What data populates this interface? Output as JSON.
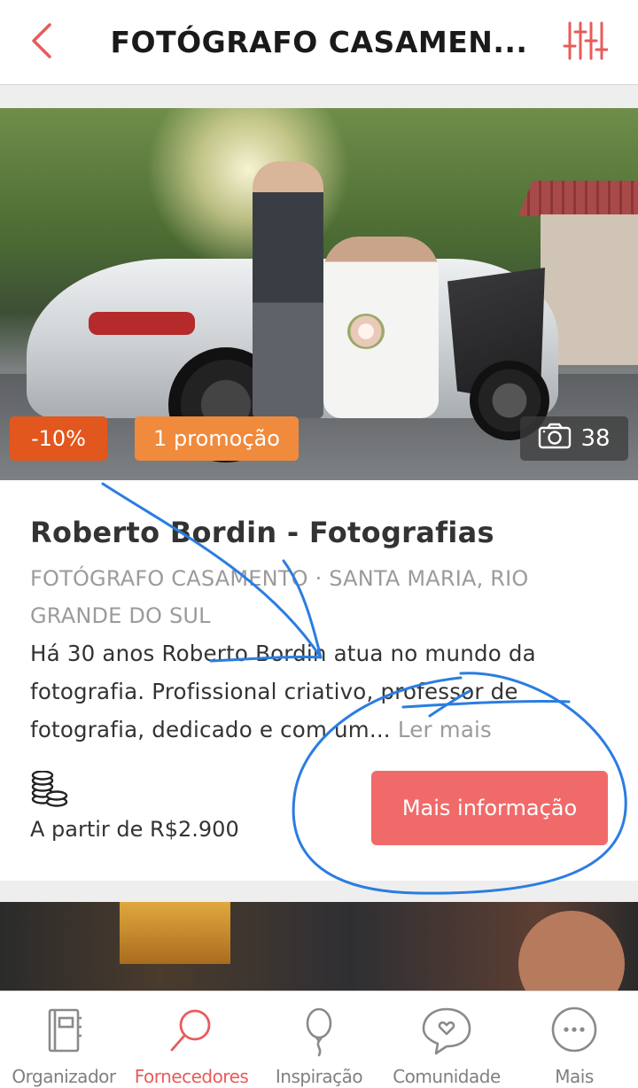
{
  "header": {
    "title": "FOTÓGRAFO CASAMEN...",
    "back_icon": "chevron-left-icon",
    "filter_icon": "sliders-icon"
  },
  "colors": {
    "accent": "#e85b5b",
    "button": "#f16a6a",
    "discount_badge": "#e2571d",
    "promo_badge": "#f08a3c",
    "annotation": "#2b7de0"
  },
  "vendor_card": {
    "discount_badge": "-10%",
    "promo_badge": "1 promoção",
    "photo_count": "38",
    "name": "Roberto Bordin - Fotografias",
    "category_location": "FOTÓGRAFO CASAMENTO · SANTA MARIA, RIO GRANDE DO SUL",
    "description": "Há 30 anos Roberto Bordin atua no mundo da fotografia. Profissional criativo, professor de fotografia, dedicado e com um...",
    "read_more": "Ler mais",
    "price_icon": "coins-icon",
    "price": "A partir de R$2.900",
    "more_button": "Mais informação"
  },
  "bottom_nav": {
    "items": [
      {
        "label": "Organizador",
        "icon": "notebook-icon",
        "active": false
      },
      {
        "label": "Fornecedores",
        "icon": "magnifier-icon",
        "active": true
      },
      {
        "label": "Inspiração",
        "icon": "balloon-icon",
        "active": false
      },
      {
        "label": "Comunidade",
        "icon": "chat-heart-icon",
        "active": false
      },
      {
        "label": "Mais",
        "icon": "more-dots-icon",
        "active": false
      }
    ]
  }
}
